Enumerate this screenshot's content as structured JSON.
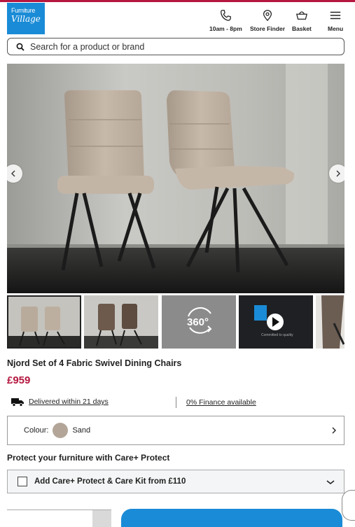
{
  "header": {
    "logo_line1": "Furniture",
    "logo_line2": "Village",
    "nav": [
      {
        "label": "10am - 8pm",
        "icon": "phone-icon"
      },
      {
        "label": "Store Finder",
        "icon": "location-pin-icon"
      },
      {
        "label": "Basket",
        "icon": "basket-icon"
      },
      {
        "label": "Menu",
        "icon": "hamburger-menu-icon"
      }
    ]
  },
  "search": {
    "placeholder": "Search for a product or brand"
  },
  "gallery": {
    "thumbnail_360_label": "360°",
    "video_caption": "Committed to quality"
  },
  "product": {
    "title": "Njord Set of 4 Fabric Swivel Dining Chairs",
    "price": "£959",
    "delivery_link": "Delivered within 21 days",
    "finance_link": "0% Finance available"
  },
  "colour": {
    "label": "Colour:",
    "value": "Sand",
    "swatch_color": "#b3a699"
  },
  "care": {
    "heading": "Protect your furniture with Care+ Protect",
    "option_label": "Add Care+ Protect & Care Kit from £110"
  },
  "colors": {
    "brand_red": "#b5173f",
    "brand_blue": "#1a8bd6"
  }
}
